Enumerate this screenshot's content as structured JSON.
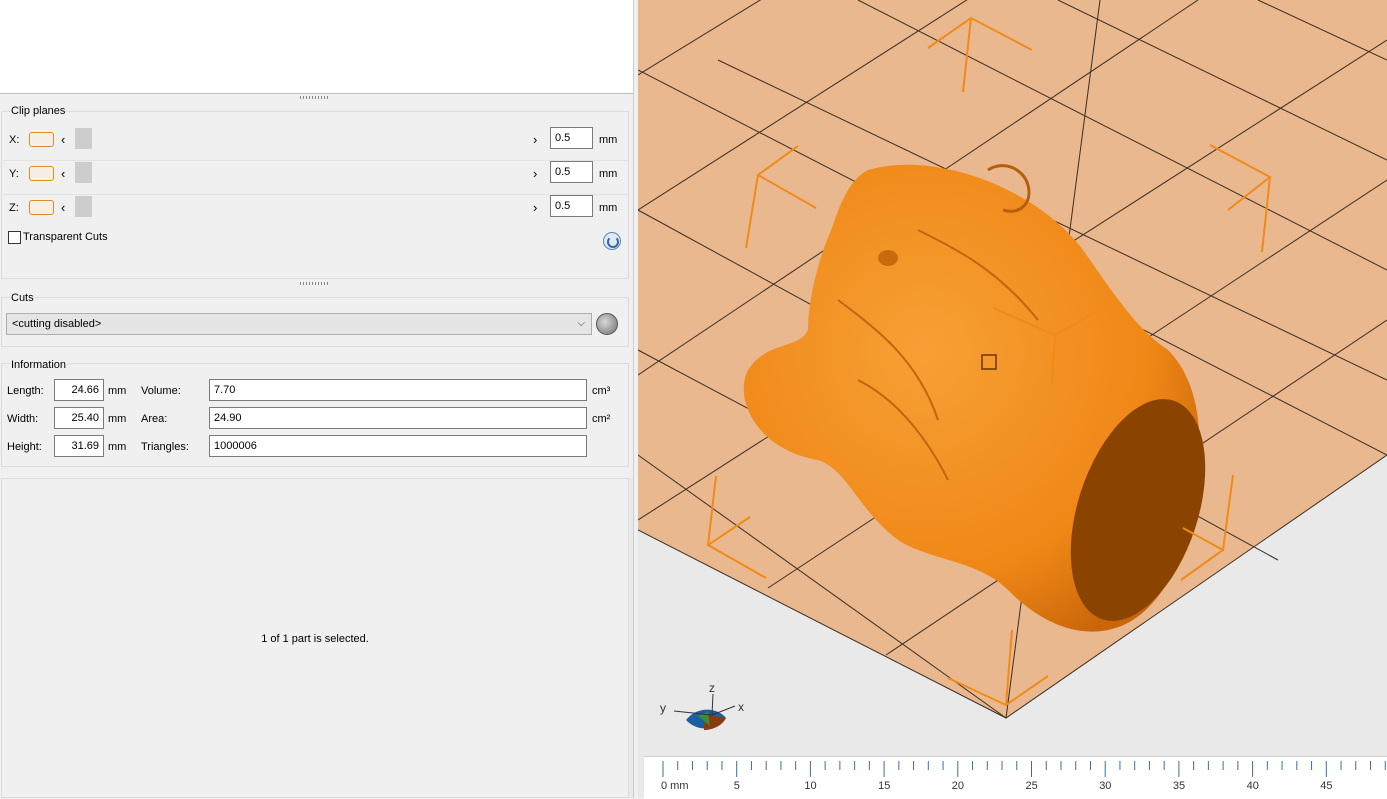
{
  "clip_planes": {
    "title": "Clip planes",
    "rows": [
      {
        "axis": "X:",
        "value": "0.5",
        "unit": "mm"
      },
      {
        "axis": "Y:",
        "value": "0.5",
        "unit": "mm"
      },
      {
        "axis": "Z:",
        "value": "0.5",
        "unit": "mm"
      }
    ],
    "transparent_cuts_label": "Transparent Cuts",
    "transparent_cuts_checked": false
  },
  "cuts": {
    "title": "Cuts",
    "selected": "<cutting disabled>"
  },
  "information": {
    "title": "Information",
    "length_label": "Length:",
    "length_value": "24.66",
    "length_unit": "mm",
    "width_label": "Width:",
    "width_value": "25.40",
    "width_unit": "mm",
    "height_label": "Height:",
    "height_value": "31.69",
    "height_unit": "mm",
    "volume_label": "Volume:",
    "volume_value": "7.70",
    "volume_unit": "cm³",
    "area_label": "Area:",
    "area_value": "24.90",
    "area_unit": "cm²",
    "triangles_label": "Triangles:",
    "triangles_value": "1000006"
  },
  "selection_message": "1 of 1 part is selected.",
  "axis_gizmo": {
    "x": "x",
    "y": "y",
    "z": "z"
  },
  "ruler": {
    "labels": [
      "0 mm",
      "5",
      "10",
      "15",
      "20",
      "25",
      "30",
      "35",
      "40",
      "45"
    ]
  },
  "colors": {
    "model": "#f08a1a",
    "model_shadow": "#8a4400",
    "build_plate": "#e9b88e",
    "handle": "#f08a1a",
    "panel_bg": "#f0f0f0"
  }
}
